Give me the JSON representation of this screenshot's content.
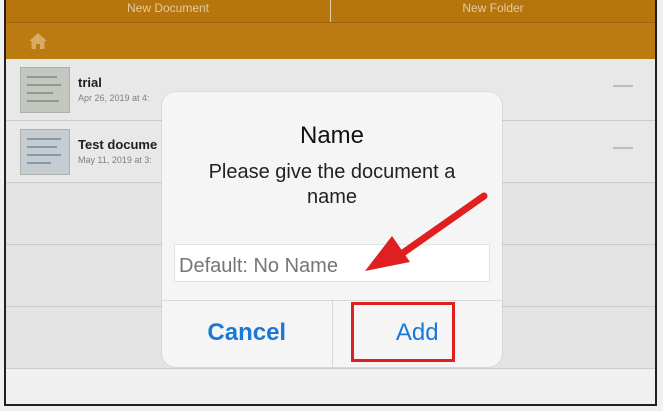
{
  "toolbar": {
    "new_document": "New Document",
    "new_folder": "New Folder"
  },
  "breadcrumb": {
    "icon": "home-icon"
  },
  "documents": [
    {
      "title": "trial",
      "date": "Apr 26, 2019 at 4:"
    },
    {
      "title": "Test docume",
      "date": "May 11, 2019 at 3:"
    }
  ],
  "dialog": {
    "title": "Name",
    "message": "Please give the document a name",
    "input_placeholder": "Default: No Name",
    "cancel_label": "Cancel",
    "add_label": "Add"
  },
  "colors": {
    "toolbar": "#c27d0e",
    "accent": "#1a78d6",
    "highlight": "#e02020"
  }
}
